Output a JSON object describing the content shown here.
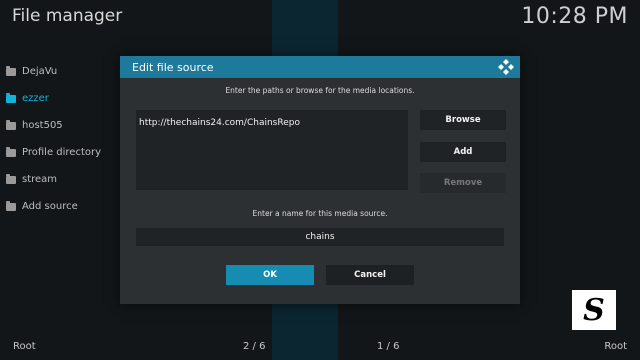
{
  "app": {
    "title": "File manager",
    "clock": "10:28 PM"
  },
  "sidebar": {
    "items": [
      {
        "label": "DejaVu"
      },
      {
        "label": "ezzer"
      },
      {
        "label": "host505"
      },
      {
        "label": "Profile directory"
      },
      {
        "label": "stream"
      },
      {
        "label": "Add source"
      }
    ],
    "active_item": "ezzer"
  },
  "footer": {
    "left_root": "Root",
    "left_page": "2 / 6",
    "right_page": "1 / 6",
    "right_root": "Root"
  },
  "dialog": {
    "title": "Edit file source",
    "paths_instruction": "Enter the paths or browse for the media locations.",
    "paths": [
      "http://thechains24.com/ChainsRepo"
    ],
    "browse_label": "Browse",
    "add_label": "Add",
    "remove_label": "Remove",
    "name_instruction": "Enter a name for this media source.",
    "name_value": "chains",
    "ok_label": "OK",
    "cancel_label": "Cancel"
  },
  "logo": {
    "letter": "S"
  },
  "colors": {
    "accent": "#12b3d9",
    "header": "#1d7a9a",
    "ok_button": "#178cb3"
  }
}
